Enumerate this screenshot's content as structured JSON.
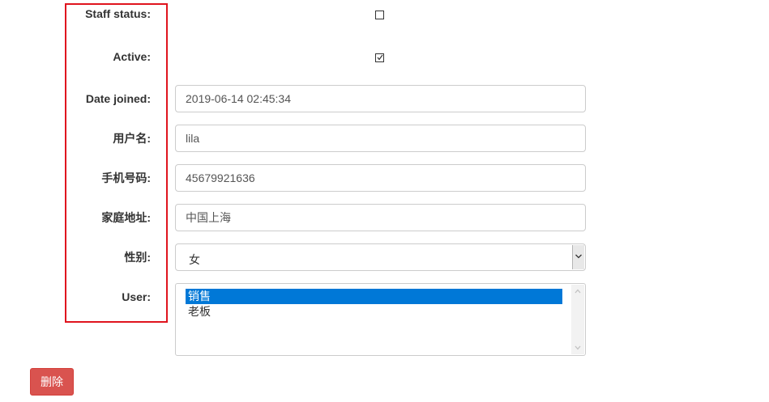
{
  "form": {
    "staff_status": {
      "label": "Staff status:",
      "checked": false
    },
    "active": {
      "label": "Active:",
      "checked": true
    },
    "date_joined": {
      "label": "Date joined:",
      "value": "2019-06-14 02:45:34"
    },
    "username": {
      "label": "用户名:",
      "value": "lila"
    },
    "phone": {
      "label": "手机号码:",
      "value": "45679921636"
    },
    "address": {
      "label": "家庭地址:",
      "value": "中国上海"
    },
    "gender": {
      "label": "性别:",
      "selected": "女"
    },
    "user": {
      "label": "User:",
      "options": [
        "销售",
        "老板"
      ],
      "selected_index": 0
    }
  },
  "actions": {
    "delete_label": "删除"
  },
  "colors": {
    "highlight_border": "#e0141e",
    "danger": "#d9534f",
    "selection": "#0078d7"
  }
}
